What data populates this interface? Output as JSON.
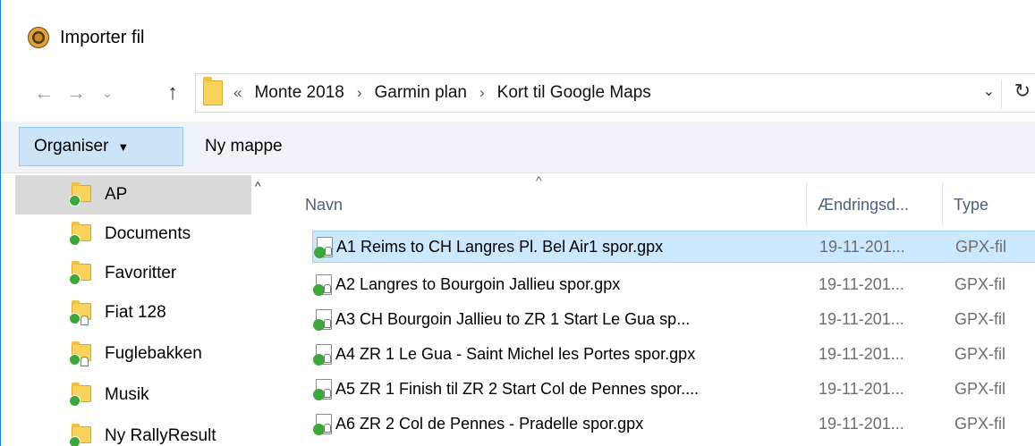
{
  "window": {
    "title": "Importer fil",
    "icon": "app-disc-icon",
    "border_color": "#1883d7"
  },
  "navigation": {
    "back_icon": "←",
    "forward_icon": "→",
    "recent_icon": "⌄",
    "up_icon": "↑"
  },
  "address_bar": {
    "overflow": "«",
    "crumbs": [
      "Monte 2018",
      "Garmin plan",
      "Kort til Google Maps"
    ],
    "separator": "›",
    "dropdown_icon": "⌄",
    "refresh_icon": "↻"
  },
  "toolbar": {
    "organise_label": "Organiser",
    "organise_caret": "▼",
    "new_folder_label": "Ny mappe",
    "accent": "#cce4f7"
  },
  "nav_pane": {
    "scroll_up_icon": "^",
    "items": [
      {
        "label": "AP",
        "selected": true,
        "overlay": "sync-check"
      },
      {
        "label": "Documents",
        "selected": false,
        "overlay": "sync-check"
      },
      {
        "label": "Favoritter",
        "selected": false,
        "overlay": "sync-check"
      },
      {
        "label": "Fiat 128",
        "selected": false,
        "overlay": "shared"
      },
      {
        "label": "Fuglebakken",
        "selected": false,
        "overlay": "shared"
      },
      {
        "label": "Musik",
        "selected": false,
        "overlay": "sync-check"
      },
      {
        "label": "Ny RallyResult",
        "selected": false,
        "overlay": "sync-check"
      }
    ]
  },
  "file_list": {
    "sort_indicator": "^",
    "columns": [
      "Navn",
      "Ændringsd...",
      "Type"
    ],
    "rows": [
      {
        "name": "A1 Reims to CH Langres Pl. Bel Air1 spor.gpx",
        "date": "19-11-201...",
        "type": "GPX-fil",
        "selected": true
      },
      {
        "name": "A2 Langres to Bourgoin Jallieu spor.gpx",
        "date": "19-11-201...",
        "type": "GPX-fil",
        "selected": false
      },
      {
        "name": "A3 CH Bourgoin Jallieu to ZR 1 Start Le Gua sp...",
        "date": "19-11-201...",
        "type": "GPX-fil",
        "selected": false
      },
      {
        "name": "A4 ZR 1 Le Gua - Saint Michel les Portes spor.gpx",
        "date": "19-11-201...",
        "type": "GPX-fil",
        "selected": false
      },
      {
        "name": "A5 ZR 1 Finish til ZR 2 Start Col de Pennes spor....",
        "date": "19-11-201...",
        "type": "GPX-fil",
        "selected": false
      },
      {
        "name": "A6 ZR 2 Col de Pennes - Pradelle spor.gpx",
        "date": "19-11-201...",
        "type": "GPX-fil",
        "selected": false
      }
    ],
    "selection_color": "#cce8ff"
  }
}
